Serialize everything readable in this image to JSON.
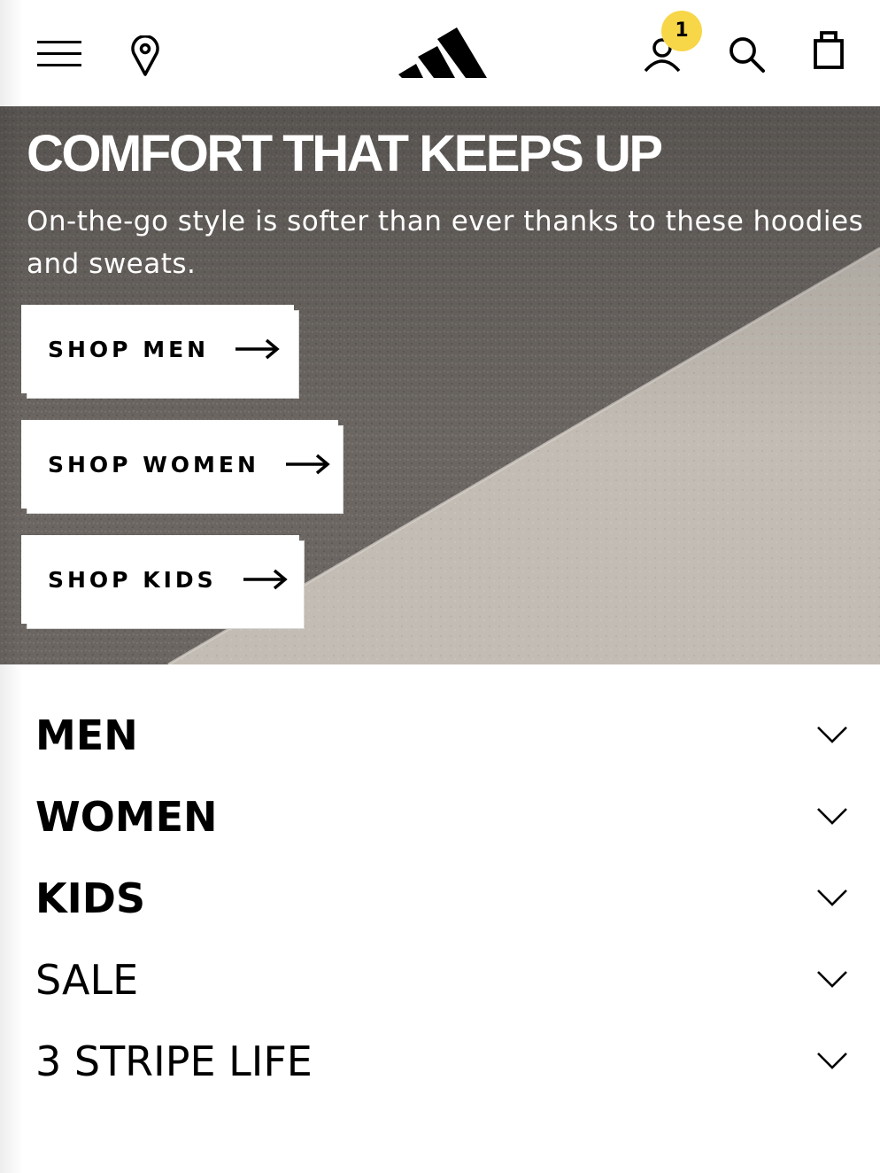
{
  "header": {
    "menu_icon": "hamburger-menu-icon",
    "location_icon": "location-pin-icon",
    "logo_icon": "adidas-performance-logo",
    "account_icon": "account-icon",
    "account_badge": "1",
    "badge_color": "#f7d648",
    "search_icon": "search-icon",
    "bag_icon": "shopping-bag-icon"
  },
  "hero": {
    "title": "COMFORT THAT KEEPS UP",
    "subtitle": "On-the-go style is softer than ever thanks to these hoodies and sweats.",
    "ctas": [
      {
        "label": "SHOP MEN"
      },
      {
        "label": "SHOP WOMEN"
      },
      {
        "label": "SHOP KIDS"
      }
    ]
  },
  "nav": {
    "items": [
      {
        "label": "MEN",
        "weight": "bold"
      },
      {
        "label": "WOMEN",
        "weight": "bold"
      },
      {
        "label": "KIDS",
        "weight": "bold"
      },
      {
        "label": "SALE",
        "weight": "light"
      },
      {
        "label": "3 STRIPE LIFE",
        "weight": "light"
      }
    ]
  }
}
